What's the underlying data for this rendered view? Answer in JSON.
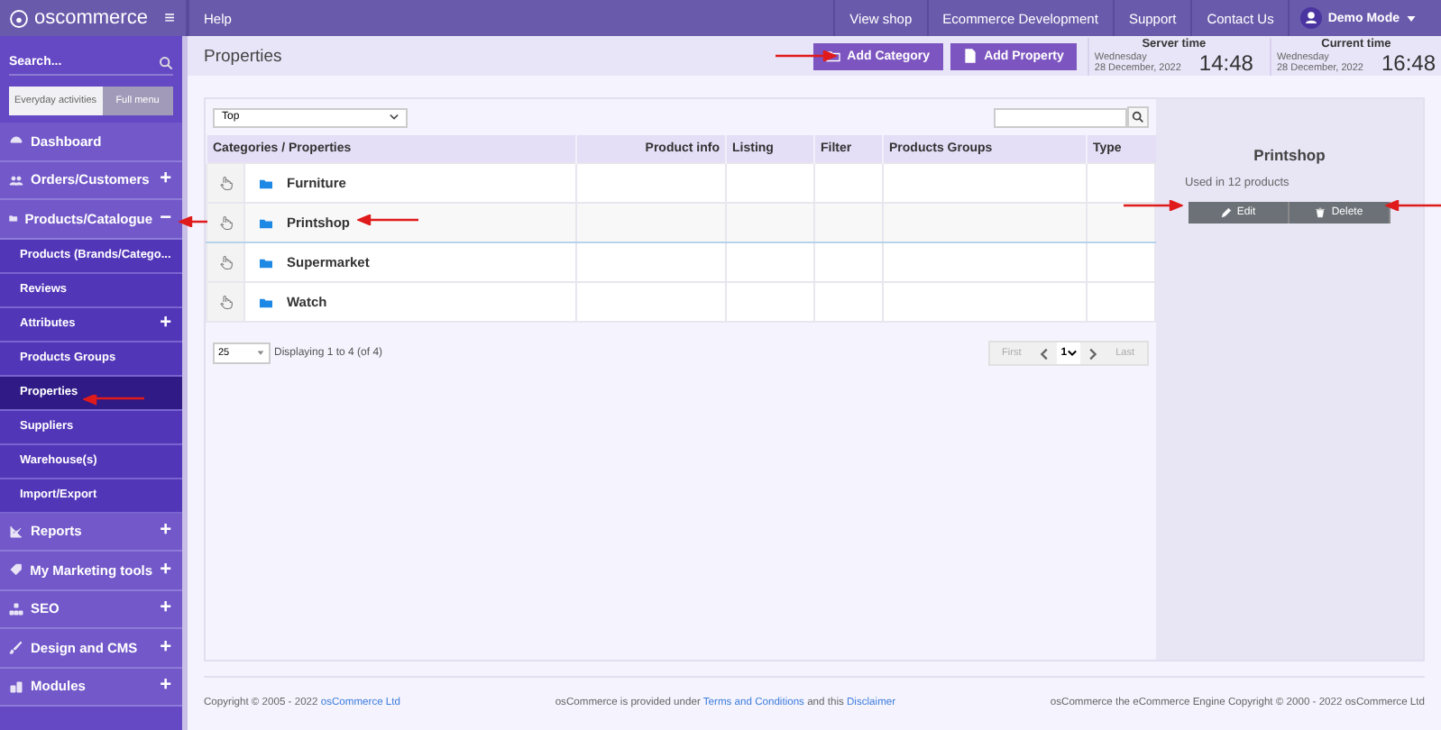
{
  "topbar": {
    "logo": "oscommerce",
    "menu_icon": "≡",
    "left_links": [
      "Help"
    ],
    "right_links": [
      "View shop",
      "Ecommerce Development",
      "Support",
      "Contact Us"
    ],
    "user": "Demo Mode"
  },
  "sidebar": {
    "search": {
      "placeholder": "Search..."
    },
    "modes": [
      {
        "label": "Everyday activities",
        "selected": false
      },
      {
        "label": "Full menu",
        "selected": true
      }
    ],
    "items": [
      {
        "kind": "main",
        "label": "Dashboard",
        "selected": false
      },
      {
        "kind": "main",
        "label": "Orders/Customers",
        "toggle": "+",
        "selected": false
      },
      {
        "kind": "main",
        "label": "Products/Catalogue",
        "toggle": "−",
        "selected": false
      },
      {
        "kind": "sub",
        "label": "Products (Brands/Catego...",
        "selected": false
      },
      {
        "kind": "sub",
        "label": "Reviews",
        "selected": false
      },
      {
        "kind": "sub",
        "label": "Attributes",
        "toggle": "+",
        "selected": false
      },
      {
        "kind": "sub",
        "label": "Products Groups",
        "selected": false
      },
      {
        "kind": "sub",
        "label": "Properties",
        "selected": true
      },
      {
        "kind": "sub",
        "label": "Suppliers",
        "selected": false
      },
      {
        "kind": "sub",
        "label": "Warehouse(s)",
        "selected": false
      },
      {
        "kind": "sub",
        "label": "Import/Export",
        "selected": false
      },
      {
        "kind": "main",
        "label": "Reports",
        "toggle": "+",
        "selected": false
      },
      {
        "kind": "main",
        "label": "My Marketing tools",
        "toggle": "+",
        "selected": false
      },
      {
        "kind": "main",
        "label": "SEO",
        "toggle": "+",
        "selected": false
      },
      {
        "kind": "main",
        "label": "Design and CMS",
        "toggle": "+",
        "selected": false
      },
      {
        "kind": "main",
        "label": "Modules",
        "toggle": "+",
        "selected": false
      }
    ]
  },
  "page": {
    "title": "Properties",
    "buttons": [
      {
        "label": "Add Category"
      },
      {
        "label": "Add Property"
      }
    ],
    "clocks": [
      {
        "label": "Server time",
        "day": "Wednesday",
        "date": "28 December, 2022",
        "time": "14:48"
      },
      {
        "label": "Current time",
        "day": "Wednesday",
        "date": "28 December, 2022",
        "time": "16:48"
      }
    ]
  },
  "filter": {
    "value": "Top"
  },
  "table": {
    "columns": [
      "Categories / Properties",
      "Product info",
      "Listing",
      "Filter",
      "Products Groups",
      "Type"
    ],
    "rows": [
      {
        "name": "Furniture",
        "selected": false
      },
      {
        "name": "Printshop",
        "selected": true
      },
      {
        "name": "Supermarket",
        "selected": false
      },
      {
        "name": "Watch",
        "selected": false
      }
    ]
  },
  "pager": {
    "per_page": "25",
    "summary": "Displaying 1 to 4 (of 4)",
    "first": "First",
    "page": "1",
    "last": "Last"
  },
  "detail": {
    "title": "Printshop",
    "text": "Used in 12 products",
    "buttons": [
      "Edit",
      "Delete"
    ]
  },
  "footer": {
    "left": "Copyright © 2005 - 2022 ",
    "left_link": "osCommerce Ltd",
    "mid": "osCommerce is provided under ",
    "mid_link1": "Terms and Conditions",
    "mid_and": " and this ",
    "mid_link2": "Disclaimer",
    "right": "osCommerce the eCommerce Engine Copyright © 2000 - 2022 osCommerce Ltd"
  }
}
